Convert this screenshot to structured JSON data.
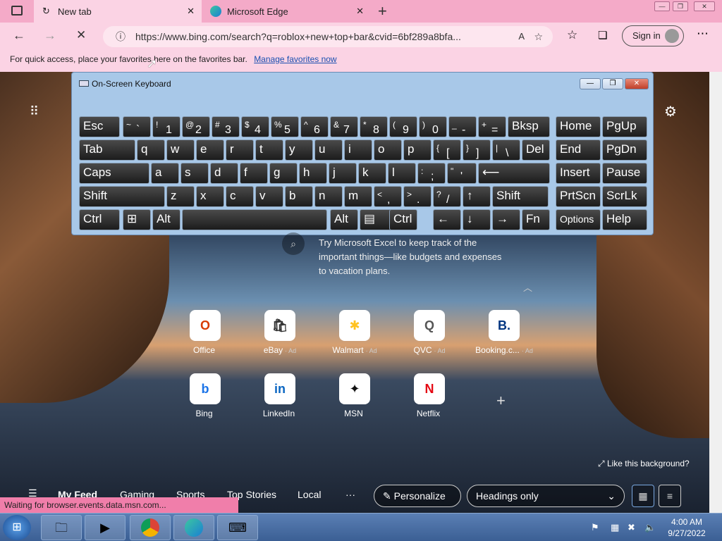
{
  "tabs": [
    {
      "title": "New tab",
      "close": "✕"
    },
    {
      "title": "Microsoft Edge",
      "close": "✕"
    }
  ],
  "address": {
    "url": "https://www.bing.com/search?q=roblox+new+top+bar&cvid=6bf289a8bfa...",
    "sign_in": "Sign in"
  },
  "favbar": {
    "text": "For quick access, place your favorites here on the favorites bar.",
    "link": "Manage favorites now"
  },
  "osk": {
    "title": "On-Screen Keyboard",
    "rows": [
      [
        {
          "t": "Esc"
        },
        {
          "s": "~",
          "l": "`"
        },
        {
          "s": "!",
          "l": "1"
        },
        {
          "s": "@",
          "l": "2"
        },
        {
          "s": "#",
          "l": "3"
        },
        {
          "s": "$",
          "l": "4"
        },
        {
          "s": "%",
          "l": "5"
        },
        {
          "s": "^",
          "l": "6"
        },
        {
          "s": "&",
          "l": "7"
        },
        {
          "s": "*",
          "l": "8"
        },
        {
          "s": "(",
          "l": "9"
        },
        {
          "s": ")",
          "l": "0"
        },
        {
          "s": "_",
          "l": "-"
        },
        {
          "s": "+",
          "l": "="
        },
        {
          "t": "Bksp"
        },
        {
          "t": "Home"
        },
        {
          "t": "PgUp"
        }
      ],
      [
        {
          "t": "Tab"
        },
        {
          "t": "q"
        },
        {
          "t": "w"
        },
        {
          "t": "e"
        },
        {
          "t": "r"
        },
        {
          "t": "t"
        },
        {
          "t": "y"
        },
        {
          "t": "u"
        },
        {
          "t": "i"
        },
        {
          "t": "o"
        },
        {
          "t": "p"
        },
        {
          "s": "{",
          "l": "["
        },
        {
          "s": "}",
          "l": "]"
        },
        {
          "s": "|",
          "l": "\\"
        },
        {
          "t": "Del"
        },
        {
          "t": "End"
        },
        {
          "t": "PgDn"
        }
      ],
      [
        {
          "t": "Caps"
        },
        {
          "t": "a"
        },
        {
          "t": "s"
        },
        {
          "t": "d"
        },
        {
          "t": "f"
        },
        {
          "t": "g"
        },
        {
          "t": "h"
        },
        {
          "t": "j"
        },
        {
          "t": "k"
        },
        {
          "t": "l"
        },
        {
          "s": ":",
          "l": ";"
        },
        {
          "s": "\"",
          "l": "'"
        },
        {
          "t": "⟵"
        },
        {
          "t": "Insert"
        },
        {
          "t": "Pause"
        }
      ],
      [
        {
          "t": "Shift"
        },
        {
          "t": "z"
        },
        {
          "t": "x"
        },
        {
          "t": "c"
        },
        {
          "t": "v"
        },
        {
          "t": "b"
        },
        {
          "t": "n"
        },
        {
          "t": "m"
        },
        {
          "s": "<",
          "l": ","
        },
        {
          "s": ">",
          "l": "."
        },
        {
          "s": "?",
          "l": "/"
        },
        {
          "t": "↑"
        },
        {
          "t": "Shift"
        },
        {
          "t": "PrtScn"
        },
        {
          "t": "ScrLk"
        }
      ],
      [
        {
          "t": "Ctrl"
        },
        {
          "t": "⊞"
        },
        {
          "t": "Alt"
        },
        {
          "t": ""
        },
        {
          "t": "Alt"
        },
        {
          "t": "▤"
        },
        {
          "t": "Ctrl"
        },
        {
          "t": "←"
        },
        {
          "t": "↓"
        },
        {
          "t": "→"
        },
        {
          "t": "Fn"
        },
        {
          "t": "Options"
        },
        {
          "t": "Help"
        }
      ]
    ]
  },
  "promo": "Try Microsoft Excel to keep track of the important things—like budgets and expenses to vacation plans.",
  "tiles": [
    {
      "label": "Office",
      "ad": "",
      "glyph": "O",
      "color": "#d83b01"
    },
    {
      "label": "eBay",
      "ad": "· Ad",
      "glyph": "🛍",
      "color": "#333"
    },
    {
      "label": "Walmart",
      "ad": "· Ad",
      "glyph": "✱",
      "color": "#ffc220"
    },
    {
      "label": "QVC",
      "ad": "· Ad",
      "glyph": "Q",
      "color": "#555"
    },
    {
      "label": "Booking.c...",
      "ad": "· Ad",
      "glyph": "B.",
      "color": "#003580"
    },
    {
      "label": "Bing",
      "ad": "",
      "glyph": "b",
      "color": "#1a73e8"
    },
    {
      "label": "LinkedIn",
      "ad": "",
      "glyph": "in",
      "color": "#0a66c2"
    },
    {
      "label": "MSN",
      "ad": "",
      "glyph": "✦",
      "color": "#111"
    },
    {
      "label": "Netflix",
      "ad": "",
      "glyph": "N",
      "color": "#e50914"
    }
  ],
  "like_bg": "Like this background?",
  "feed": {
    "items": [
      "My Feed",
      "Gaming",
      "Sports",
      "Top Stories",
      "Local",
      "···"
    ],
    "personalize": "Personalize",
    "headings": "Headings only"
  },
  "status": "Waiting for browser.events.data.msn.com...",
  "clock": {
    "time": "4:00 AM",
    "date": "9/27/2022"
  }
}
